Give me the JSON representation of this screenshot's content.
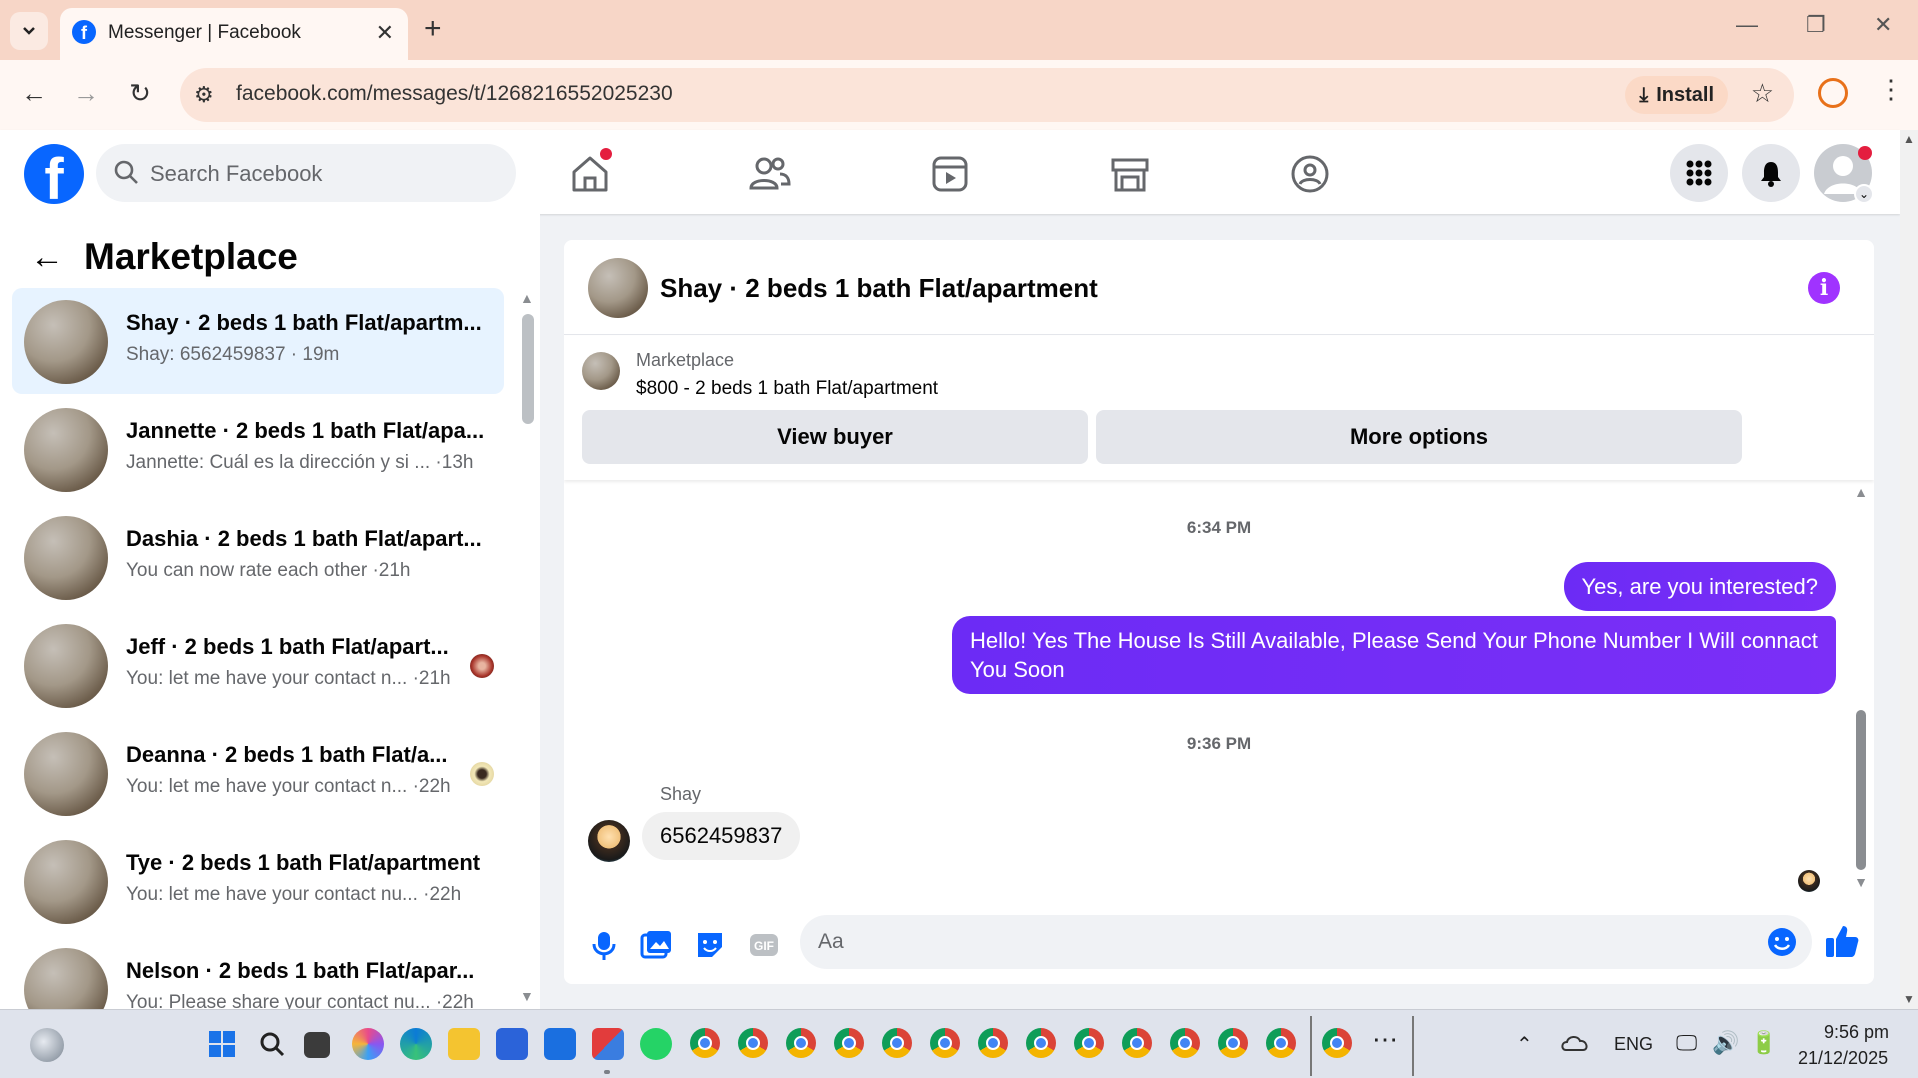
{
  "browser": {
    "tab_title": "Messenger | Facebook",
    "url": "facebook.com/messages/t/1268216552025230",
    "install_label": "Install"
  },
  "header": {
    "search_placeholder": "Search Facebook"
  },
  "left_panel": {
    "title": "Marketplace",
    "conversations": [
      {
        "name": "Shay · 2 beds 1 bath Flat/apartm...",
        "snippet": "Shay: 6562459837 · 19m"
      },
      {
        "name": "Jannette · 2 beds 1 bath Flat/apa...",
        "snippet": "Jannette: Cuál es la dirección y si ... ·13h"
      },
      {
        "name": "Dashia · 2 beds 1 bath Flat/apart...",
        "snippet": "You can now rate each other ·21h"
      },
      {
        "name": "Jeff · 2 beds 1 bath Flat/apart...",
        "snippet": "You: let me have your contact n... ·21h"
      },
      {
        "name": "Deanna · 2 beds 1 bath Flat/a...",
        "snippet": "You: let me have your contact n... ·22h"
      },
      {
        "name": "Tye · 2 beds 1 bath Flat/apartment",
        "snippet": "You: let me have your contact nu... ·22h"
      },
      {
        "name": "Nelson · 2 beds 1 bath Flat/apar...",
        "snippet": "You: Please share your contact nu... ·22h"
      }
    ]
  },
  "chat": {
    "title": "Shay · 2 beds 1 bath Flat/apartment",
    "marketplace_label": "Marketplace",
    "listing": "$800 - 2 beds 1 bath Flat/apartment",
    "view_buyer": "View buyer",
    "more_options": "More options",
    "timestamp_1": "6:34 PM",
    "msg_out_1": "Yes, are you interested?",
    "msg_out_2": "Hello! Yes The House  Is Still Available, Please Send Your Phone Number I Will connact You Soon",
    "timestamp_2": "9:36 PM",
    "sender": "Shay",
    "msg_in_1": "6562459837",
    "composer_placeholder": "Aa"
  },
  "taskbar": {
    "language": "ENG",
    "time": "9:56 pm",
    "date": "21/12/2025"
  },
  "colors": {
    "fb_blue": "#0866ff",
    "message_purple": "#7b2ff7",
    "active_conv": "#e7f3ff"
  }
}
